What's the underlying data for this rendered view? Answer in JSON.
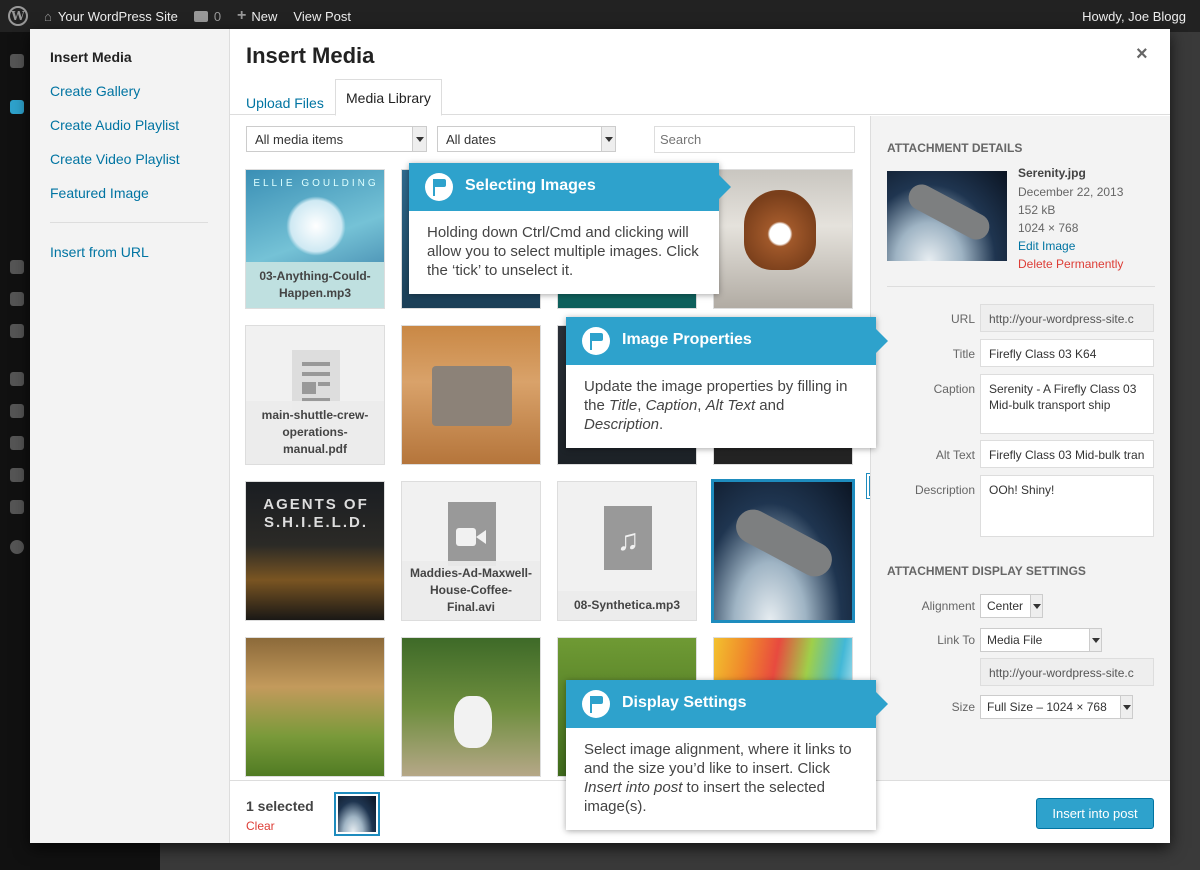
{
  "adminbar": {
    "site_name": "Your WordPress Site",
    "comments_count": "0",
    "new_label": "New",
    "view_post_label": "View Post",
    "greeting": "Howdy, Joe Blogg"
  },
  "modal": {
    "title": "Insert Media",
    "close_symbol": "×",
    "menu": {
      "insert_media": "Insert Media",
      "create_gallery": "Create Gallery",
      "create_audio_playlist": "Create Audio Playlist",
      "create_video_playlist": "Create Video Playlist",
      "featured_image": "Featured Image",
      "insert_from_url": "Insert from URL"
    },
    "tabs": {
      "upload": "Upload Files",
      "library": "Media Library"
    },
    "filters": {
      "media_type": "All media items",
      "dates": "All dates",
      "search_placeholder": "Search"
    },
    "grid": [
      {
        "name": "03-Anything-Could-Happen.mp3",
        "kind": "image",
        "caption": "ELLIE GOULDING"
      },
      {
        "name": "",
        "kind": "image"
      },
      {
        "name": "",
        "kind": "image"
      },
      {
        "name": "",
        "kind": "image"
      },
      {
        "name": "main-shuttle-crew-operations-manual.pdf",
        "kind": "document-icon"
      },
      {
        "name": "",
        "kind": "image"
      },
      {
        "name": "",
        "kind": "image"
      },
      {
        "name": "",
        "kind": "image"
      },
      {
        "name": "",
        "kind": "image",
        "caption": "AGENTS OF S.H.I.E.L.D."
      },
      {
        "name": "Maddies-Ad-Maxwell-House-Coffee-Final.avi",
        "kind": "video-icon"
      },
      {
        "name": "08-Synthetica.mp3",
        "kind": "audio-icon"
      },
      {
        "name": "",
        "kind": "image",
        "selected": true
      },
      {
        "name": "",
        "kind": "image"
      },
      {
        "name": "",
        "kind": "image"
      },
      {
        "name": "",
        "kind": "image"
      },
      {
        "name": "",
        "kind": "image"
      }
    ],
    "footer": {
      "selected_count": "1 selected",
      "clear_label": "Clear",
      "insert_button": "Insert into post"
    }
  },
  "details": {
    "heading": "Attachment Details",
    "filename": "Serenity.jpg",
    "date": "December 22, 2013",
    "size": "152 kB",
    "dimensions": "1024 × 768",
    "edit_link": "Edit Image",
    "delete_link": "Delete Permanently",
    "url_label": "URL",
    "url_value": "http://your-wordpress-site.c",
    "title_label": "Title",
    "title_value": "Firefly Class 03 K64",
    "caption_label": "Caption",
    "caption_value": "Serenity - A Firefly Class 03 Mid-bulk transport ship",
    "alt_label": "Alt Text",
    "alt_value": "Firefly Class 03 Mid-bulk tran",
    "description_label": "Description",
    "description_value": "OOh! Shiny!"
  },
  "display_settings": {
    "heading": "Attachment Display Settings",
    "alignment_label": "Alignment",
    "alignment_value": "Center",
    "link_to_label": "Link To",
    "link_to_value": "Media File",
    "link_url_value": "http://your-wordpress-site.c",
    "size_label": "Size",
    "size_value": "Full Size – 1024 × 768"
  },
  "callouts": {
    "selecting": {
      "title": "Selecting Images",
      "body": "Holding down Ctrl/Cmd and clicking will allow you to select multiple images. Click the ‘tick’ to unselect it."
    },
    "properties": {
      "title": "Image Properties",
      "body_pre": "Update the image properties by filling in the ",
      "em_title": "Title",
      "sep1": ", ",
      "em_caption": "Caption",
      "sep2": ", ",
      "em_alt": "Alt Text",
      "sep3": " and ",
      "em_description": "Description",
      "end": "."
    },
    "display": {
      "title": "Display Settings",
      "body_pre": "Select image alignment, where it links to and the size you’d like to insert. Click ",
      "em_insert": "Insert into post",
      "body_post": " to insert the selected image(s)."
    }
  },
  "colors": {
    "accent": "#2ea2cc",
    "link": "#0074a2",
    "delete": "#dd3d36"
  }
}
